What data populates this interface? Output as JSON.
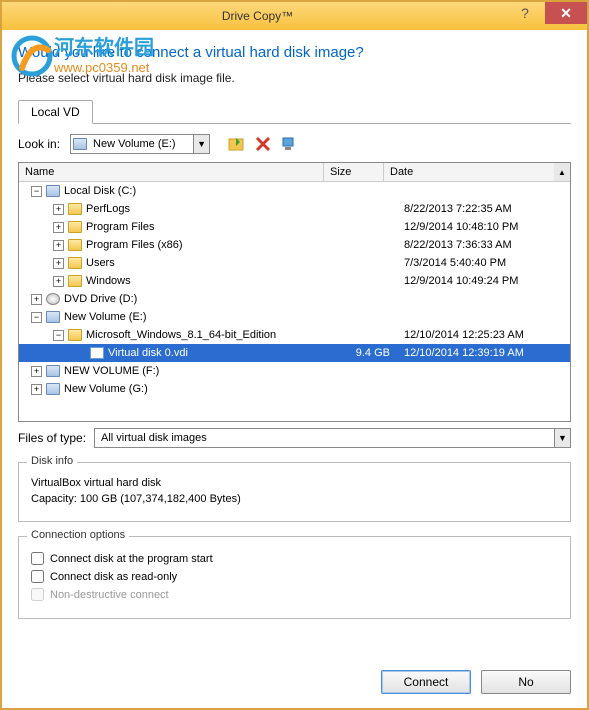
{
  "titlebar": {
    "title": "Drive Copy™"
  },
  "heading": "Would you like to connect a virtual hard disk image?",
  "subtext": "Please select virtual hard disk image file.",
  "tab": {
    "label": "Local VD"
  },
  "lookin": {
    "label": "Look in:",
    "value": "New Volume (E:)"
  },
  "columns": {
    "name": "Name",
    "size": "Size",
    "date": "Date"
  },
  "tree": [
    {
      "level": 0,
      "exp": "-",
      "icon": "disk",
      "label": "Local Disk (C:)",
      "size": "",
      "date": ""
    },
    {
      "level": 1,
      "exp": "+",
      "icon": "folder",
      "label": "PerfLogs",
      "size": "",
      "date": "8/22/2013 7:22:35 AM"
    },
    {
      "level": 1,
      "exp": "+",
      "icon": "folder",
      "label": "Program Files",
      "size": "",
      "date": "12/9/2014 10:48:10 PM"
    },
    {
      "level": 1,
      "exp": "+",
      "icon": "folder",
      "label": "Program Files (x86)",
      "size": "",
      "date": "8/22/2013 7:36:33 AM"
    },
    {
      "level": 1,
      "exp": "+",
      "icon": "folder",
      "label": "Users",
      "size": "",
      "date": "7/3/2014 5:40:40 PM"
    },
    {
      "level": 1,
      "exp": "+",
      "icon": "folder",
      "label": "Windows",
      "size": "",
      "date": "12/9/2014 10:49:24 PM"
    },
    {
      "level": 0,
      "exp": "+",
      "icon": "dvd",
      "label": "DVD Drive (D:)",
      "size": "",
      "date": ""
    },
    {
      "level": 0,
      "exp": "-",
      "icon": "disk",
      "label": "New Volume (E:)",
      "size": "",
      "date": ""
    },
    {
      "level": 1,
      "exp": "-",
      "icon": "folder",
      "label": "Microsoft_Windows_8.1_64-bit_Edition",
      "size": "",
      "date": "12/10/2014 12:25:23 AM"
    },
    {
      "level": 2,
      "exp": "",
      "icon": "file",
      "label": "Virtual disk 0.vdi",
      "size": "9.4 GB",
      "date": "12/10/2014 12:39:19 AM",
      "selected": true
    },
    {
      "level": 0,
      "exp": "+",
      "icon": "disk",
      "label": "NEW VOLUME (F:)",
      "size": "",
      "date": ""
    },
    {
      "level": 0,
      "exp": "+",
      "icon": "disk",
      "label": "New Volume (G:)",
      "size": "",
      "date": ""
    }
  ],
  "filetype": {
    "label": "Files of type:",
    "value": "All virtual disk images"
  },
  "diskinfo": {
    "title": "Disk info",
    "line1": "VirtualBox virtual hard disk",
    "line2": "Capacity:   100 GB (107,374,182,400 Bytes)"
  },
  "connopts": {
    "title": "Connection options",
    "opt1": "Connect disk at the program start",
    "opt2": "Connect disk as read-only",
    "opt3": "Non-destructive connect"
  },
  "buttons": {
    "connect": "Connect",
    "no": "No"
  },
  "watermark": {
    "text1": "河东软件园",
    "text2": "www.pc0359.net"
  }
}
